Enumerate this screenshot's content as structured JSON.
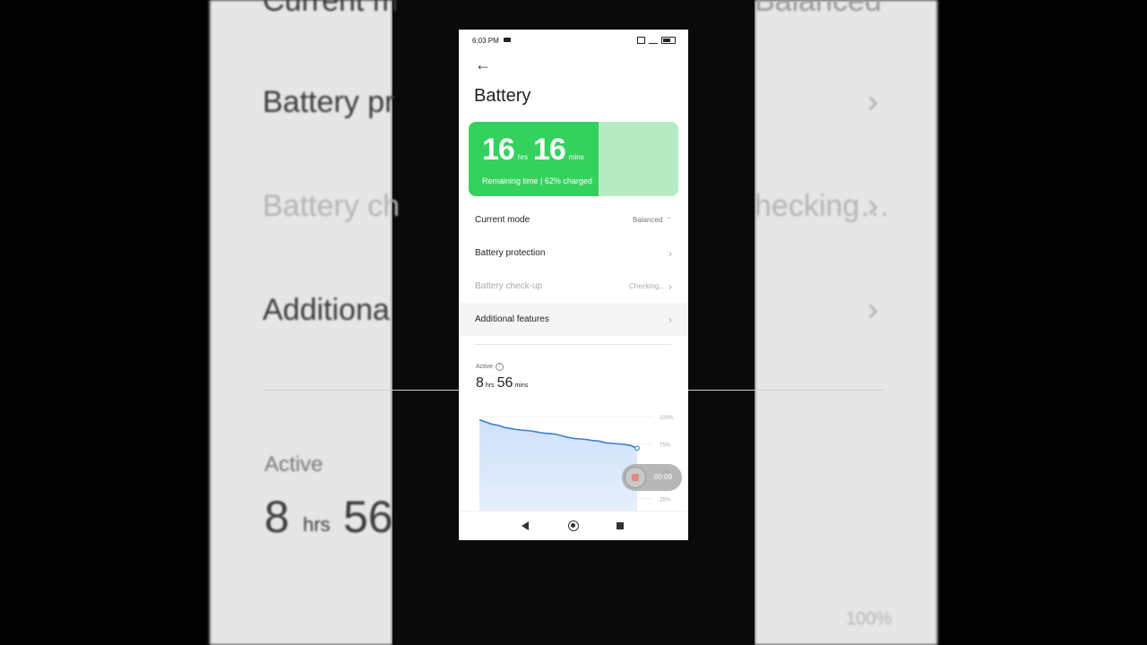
{
  "background": {
    "texts": [
      "Current m",
      "Battery pr",
      "Battery ch",
      "Additiona",
      "Active",
      "8",
      "hrs",
      "56",
      "Balanced",
      "hecking…",
      "100%"
    ]
  },
  "status_bar": {
    "time": "6:03 PM",
    "icons": [
      "video-camera-icon",
      "sim-icon",
      "signal-icon",
      "battery-icon"
    ]
  },
  "header": {
    "back_icon": "arrow-left-icon",
    "title": "Battery"
  },
  "battery_card": {
    "hours": "16",
    "hours_unit": "hrs",
    "minutes": "16",
    "minutes_unit": "mins",
    "subtitle": "Remaining time | 62% charged",
    "charge_percent": 62,
    "fill_color": "#34d15e",
    "track_color": "#b6ecc4"
  },
  "settings": {
    "current_mode": {
      "label": "Current mode",
      "value": "Balanced"
    },
    "battery_protection": {
      "label": "Battery protection"
    },
    "battery_checkup": {
      "label": "Battery check-up",
      "value": "Checking..."
    },
    "additional_features": {
      "label": "Additional features"
    }
  },
  "active": {
    "label": "Active",
    "hours": "8",
    "hours_unit": "hrs",
    "minutes": "56",
    "minutes_unit": "mins"
  },
  "chart_data": {
    "type": "area",
    "ylim": [
      0,
      100
    ],
    "ytick_labels": [
      "100%",
      "75%",
      "50%",
      "25%"
    ],
    "ytick_values": [
      100,
      75,
      50,
      25
    ],
    "x": [
      0,
      1,
      2,
      3,
      4,
      5,
      6,
      7,
      8,
      9,
      10,
      11,
      12,
      13,
      14,
      15,
      16,
      17,
      18,
      19,
      20,
      21,
      22,
      23,
      24,
      25
    ],
    "values": [
      97,
      95,
      93,
      92,
      90,
      89,
      88,
      87.5,
      87,
      86,
      85,
      84.5,
      84,
      82.5,
      81,
      80,
      79.5,
      79,
      78,
      77.5,
      76,
      75.5,
      75,
      74.5,
      73.5,
      71
    ],
    "line_color": "#3b7fd1",
    "grid": true
  },
  "recorder": {
    "time": "00:09"
  },
  "navbar": {
    "icons": [
      "nav-back-icon",
      "nav-home-icon",
      "nav-recents-icon"
    ]
  }
}
